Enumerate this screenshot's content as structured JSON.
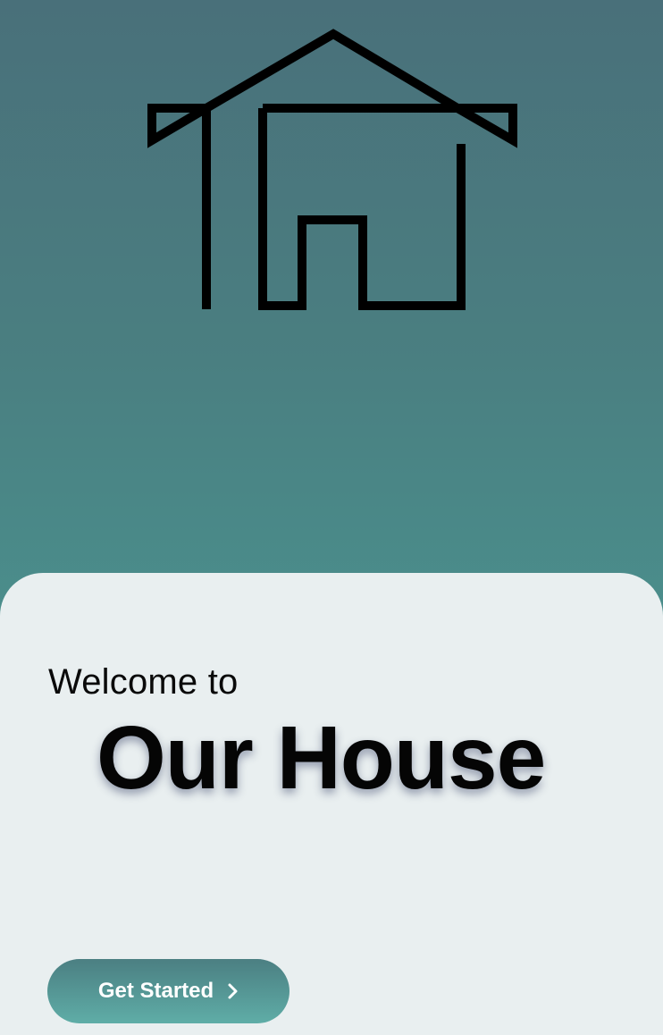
{
  "app": {
    "logo_icon": "house-outline-icon",
    "colors": {
      "gradient_top": "#49707a",
      "gradient_bottom": "#4b9691",
      "card_background": "#e9eff0",
      "button_top": "#4b7f82",
      "button_bottom": "#5fada7",
      "text": "#050505"
    }
  },
  "welcome": {
    "intro": "Welcome to",
    "title": "Our House"
  },
  "actions": {
    "get_started_label": "Get Started",
    "get_started_icon": "chevron-right-icon"
  }
}
